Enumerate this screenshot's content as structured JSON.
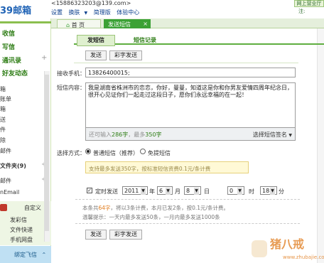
{
  "header": {
    "logo": "39邮箱",
    "email": "<15886323203@139.com>",
    "nav": [
      "设置",
      "换肤",
      "简理版",
      "体验中心"
    ],
    "right_button": "网上营业厅",
    "right_cut": "注:"
  },
  "window_tabs": [
    {
      "label": "首 页",
      "active": false
    },
    {
      "label": "发送短信",
      "active": true
    }
  ],
  "sidebar": {
    "items": [
      {
        "label": "收信",
        "style": "big"
      },
      {
        "label": "写信",
        "style": "big"
      },
      {
        "label": "通讯录",
        "style": "big",
        "expandable": true
      },
      {
        "label": "好友动态",
        "style": "big"
      },
      {
        "label": "箱",
        "style": "small"
      },
      {
        "label": "账单",
        "style": "small"
      },
      {
        "label": "箱",
        "style": "small"
      },
      {
        "label": "送",
        "style": "small"
      },
      {
        "label": "件",
        "style": "small"
      },
      {
        "label": "除",
        "style": "small"
      },
      {
        "label": "邮件",
        "style": "small"
      },
      {
        "label": "文件夹(9)",
        "style": "small",
        "expandable": true
      },
      {
        "label": "邮件",
        "style": "small",
        "expandable": true
      },
      {
        "label": "nEmail",
        "style": "small"
      }
    ],
    "custom_label": "自定义",
    "tools": [
      "发彩信",
      "文件快递",
      "手机网盘"
    ],
    "bind_bar": "绑定飞信"
  },
  "subtabs": [
    {
      "label": "发短信",
      "active": true
    },
    {
      "label": "短信记录",
      "active": false
    }
  ],
  "buttons": {
    "send": "发送",
    "mms_send": "彩字发送"
  },
  "recipient": {
    "label": "接收手机：",
    "value": "13826400015;"
  },
  "message": {
    "label": "短信内容：",
    "text": "我是湖南省株洲市的恋恋，你好，曼曼，知道这是你和你男友爱情四周年纪念日，很开心见证你们一起走过这段日子，愿你们永远幸福的在一起！",
    "counter_prefix": "还可输入",
    "counter_remaining": "286字",
    "counter_mid": "，最多",
    "counter_max": "350字",
    "signature_label": "选择短信签名"
  },
  "method": {
    "label": "选择方式：",
    "option1": "普通短信（推荐）",
    "option2": "免提短信",
    "selected": "option1",
    "hint": "支持最多发送350字，按标准短信资费0.1元/条计费"
  },
  "schedule": {
    "label": "定时发送",
    "checked": true,
    "year": "2011",
    "year_unit": "年",
    "month": "6",
    "month_unit": "月",
    "day": "8",
    "day_unit": "日",
    "hour": "0",
    "hour_unit": "时",
    "minute": "18",
    "minute_unit": "分"
  },
  "summary": {
    "line1_prefix": "本条共",
    "chars": "64字",
    "line1_rest": "，将以3条计费，本月已发2条，按0.1元/条计费。",
    "line2": "温馨提示：一天内最多发送50条，一月内最多发送1000条"
  },
  "watermark": {
    "text": "猪八戒",
    "url": "www.zhubajie.com"
  },
  "colors": {
    "brand_green": "#3ba135",
    "logo_blue": "#1e62b5",
    "highlight_green": "#2e7d15"
  }
}
